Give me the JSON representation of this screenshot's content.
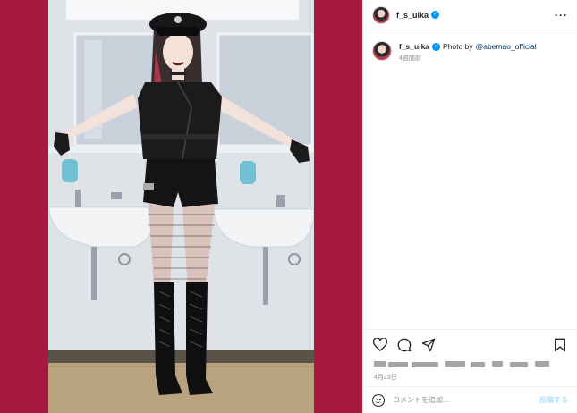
{
  "post": {
    "username": "f_s_uika",
    "verified": true,
    "colors": {
      "backdrop": "#a8173f",
      "verified": "#0095f6",
      "link": "#00376b",
      "post_button": "#b2dffc"
    }
  },
  "caption": {
    "username": "f_s_uika",
    "text": "Photo by",
    "mention": "@abemao_official",
    "time": "4週間前"
  },
  "actions": {
    "icons": [
      "heart-icon",
      "comment-icon",
      "share-icon",
      "bookmark-icon"
    ]
  },
  "date": "4月23日",
  "comment_box": {
    "placeholder": "コメントを追加...",
    "post_label": "投稿する",
    "icon": "smiley-icon"
  }
}
